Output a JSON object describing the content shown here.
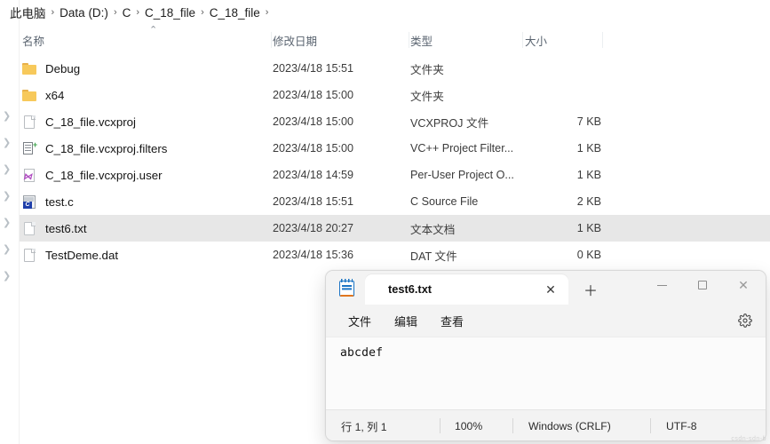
{
  "explorer": {
    "breadcrumb": {
      "name": "address-breadcrumb",
      "separator": "›",
      "items": [
        {
          "label": "此电脑"
        },
        {
          "label": "Data (D:)"
        },
        {
          "label": "C"
        },
        {
          "label": "C_18_file"
        },
        {
          "label": "C_18_file"
        }
      ]
    },
    "columns": [
      {
        "key": "name",
        "label": "名称",
        "sorted": true,
        "sort_icon": "chevron-up-icon"
      },
      {
        "key": "date",
        "label": "修改日期"
      },
      {
        "key": "type",
        "label": "类型"
      },
      {
        "key": "size",
        "label": "大小"
      }
    ],
    "rows": [
      {
        "name": "Debug",
        "date": "2023/4/18 15:51",
        "type": "文件夹",
        "size": "",
        "icon": "folder-icon",
        "selected": false
      },
      {
        "name": "x64",
        "date": "2023/4/18 15:00",
        "type": "文件夹",
        "size": "",
        "icon": "folder-icon",
        "selected": false
      },
      {
        "name": "C_18_file.vcxproj",
        "date": "2023/4/18 15:00",
        "type": "VCXPROJ 文件",
        "size": "7 KB",
        "icon": "document-icon",
        "selected": false
      },
      {
        "name": "C_18_file.vcxproj.filters",
        "date": "2023/4/18 15:00",
        "type": "VC++ Project Filter...",
        "size": "1 KB",
        "icon": "filters-file-icon",
        "selected": false
      },
      {
        "name": "C_18_file.vcxproj.user",
        "date": "2023/4/18 14:59",
        "type": "Per-User Project O...",
        "size": "1 KB",
        "icon": "vs-user-file-icon",
        "selected": false
      },
      {
        "name": "test.c",
        "date": "2023/4/18 15:51",
        "type": "C Source File",
        "size": "2 KB",
        "icon": "c-source-file-icon",
        "selected": false
      },
      {
        "name": "test6.txt",
        "date": "2023/4/18 20:27",
        "type": "文本文档",
        "size": "1 KB",
        "icon": "text-file-icon",
        "selected": true
      },
      {
        "name": "TestDeme.dat",
        "date": "2023/4/18 15:36",
        "type": "DAT 文件",
        "size": "0 KB",
        "icon": "document-icon",
        "selected": false
      }
    ],
    "selection_color": "#e7e7e7"
  },
  "notepad": {
    "app_icon": "notepad-icon",
    "tab": {
      "label": "test6.txt",
      "close_icon": "close-icon"
    },
    "new_tab_icon": "plus-icon",
    "window_controls": {
      "minimize": "minimize-icon",
      "maximize": "maximize-icon",
      "close": "close-icon"
    },
    "menu": [
      {
        "label": "文件"
      },
      {
        "label": "编辑"
      },
      {
        "label": "查看"
      }
    ],
    "settings_icon": "gear-icon",
    "content": "abcdef",
    "status": {
      "position": "行 1, 列 1",
      "zoom": "100%",
      "line_ending": "Windows (CRLF)",
      "encoding": "UTF-8"
    }
  },
  "watermark": {
    "text": "csdn-sdn-b"
  }
}
